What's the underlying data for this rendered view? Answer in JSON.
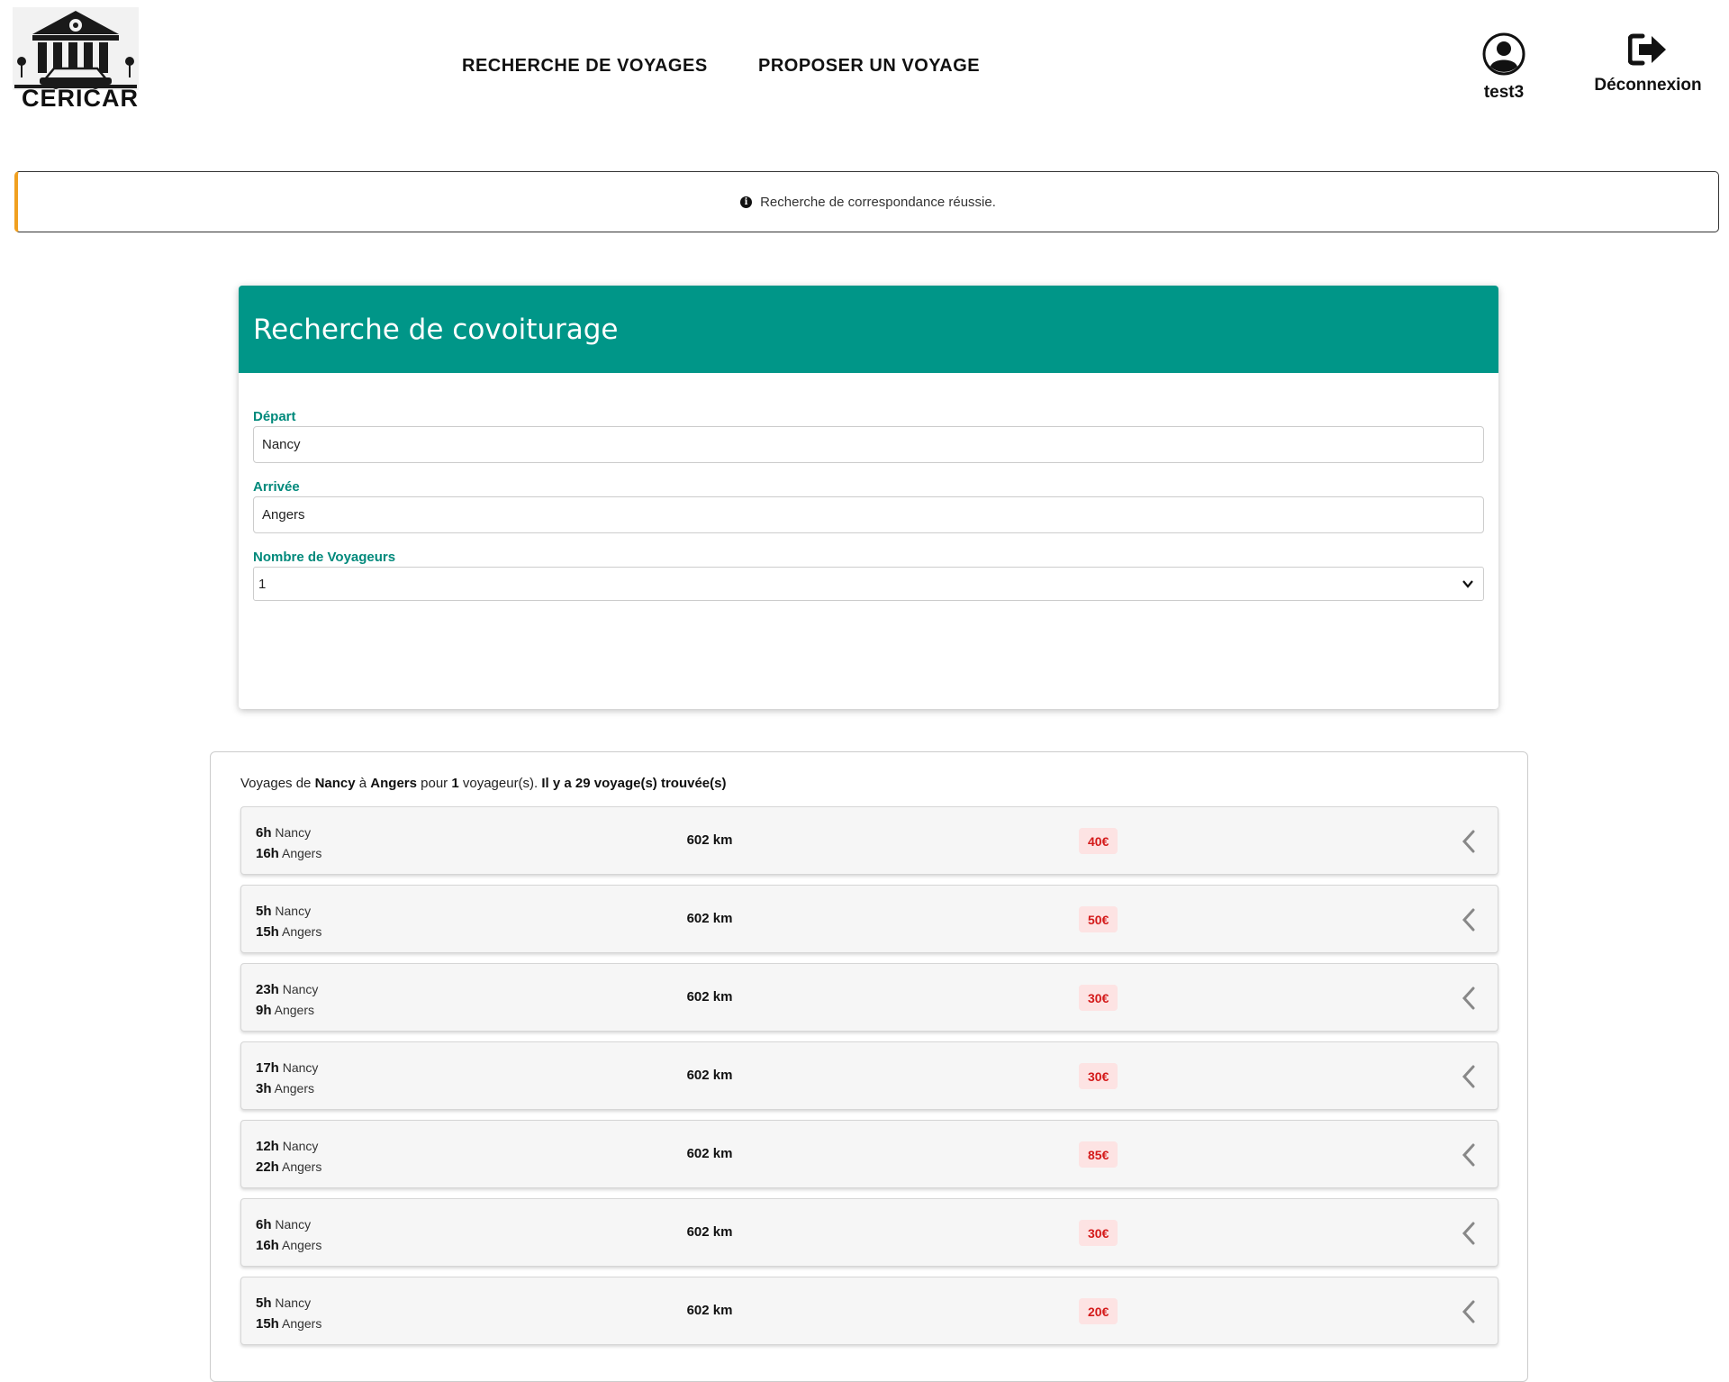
{
  "header": {
    "logo_text": "CERICAR",
    "nav": [
      "RECHERCHE DE VOYAGES",
      "PROPOSER UN VOYAGE"
    ],
    "user_name": "test3",
    "logout_label": "Déconnexion"
  },
  "alert": {
    "message": "Recherche de correspondance réussie."
  },
  "search": {
    "title": "Recherche de covoiturage",
    "depart_label": "Départ",
    "depart_value": "Nancy",
    "arrivee_label": "Arrivée",
    "arrivee_value": "Angers",
    "voyageurs_label": "Nombre de Voyageurs",
    "voyageurs_value": "1"
  },
  "results": {
    "summary": {
      "prefix": "Voyages de ",
      "from": "Nancy",
      "to_word": " à ",
      "to": "Angers",
      "pour": " pour ",
      "count_travelers": "1",
      "travelers_suffix": " voyageur(s). ",
      "found": "Il y a 29 voyage(s) trouvée(s)"
    },
    "trips": [
      {
        "dep_time": "6h",
        "dep_city": "Nancy",
        "arr_time": "16h",
        "arr_city": "Angers",
        "distance": "602 km",
        "price": "40€"
      },
      {
        "dep_time": "5h",
        "dep_city": "Nancy",
        "arr_time": "15h",
        "arr_city": "Angers",
        "distance": "602 km",
        "price": "50€"
      },
      {
        "dep_time": "23h",
        "dep_city": "Nancy",
        "arr_time": "9h",
        "arr_city": "Angers",
        "distance": "602 km",
        "price": "30€"
      },
      {
        "dep_time": "17h",
        "dep_city": "Nancy",
        "arr_time": "3h",
        "arr_city": "Angers",
        "distance": "602 km",
        "price": "30€"
      },
      {
        "dep_time": "12h",
        "dep_city": "Nancy",
        "arr_time": "22h",
        "arr_city": "Angers",
        "distance": "602 km",
        "price": "85€"
      },
      {
        "dep_time": "6h",
        "dep_city": "Nancy",
        "arr_time": "16h",
        "arr_city": "Angers",
        "distance": "602 km",
        "price": "30€"
      },
      {
        "dep_time": "5h",
        "dep_city": "Nancy",
        "arr_time": "15h",
        "arr_city": "Angers",
        "distance": "602 km",
        "price": "20€"
      }
    ]
  },
  "colors": {
    "primary": "#009688",
    "label": "#00897b",
    "alert_accent": "#f0a020",
    "price_text": "#d41a1a",
    "price_bg": "#fde3e3"
  },
  "icons": {
    "logo": "building-car-logo",
    "user": "user-circle-icon",
    "logout": "sign-out-icon",
    "alert": "info-icon",
    "search": "search-icon",
    "trip_expand": "chevron-left-icon"
  }
}
